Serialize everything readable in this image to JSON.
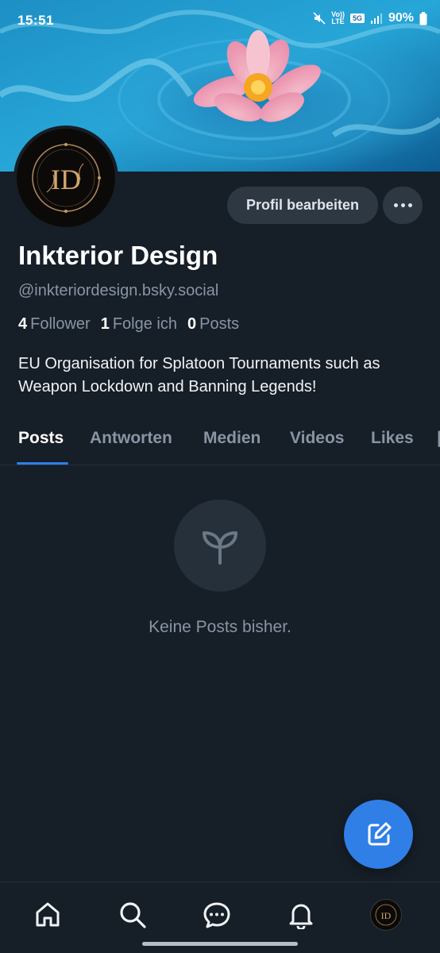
{
  "status_bar": {
    "time": "15:51",
    "volte_top": "Vo))",
    "volte_bottom": "LTE",
    "network": "5G",
    "battery": "90%"
  },
  "profile": {
    "display_name": "Inkterior Design",
    "handle": "@inkteriordesign.bsky.social",
    "avatar_monogram": "ID",
    "stats": {
      "followers_count": "4",
      "followers_label": "Follower",
      "following_count": "1",
      "following_label": "Folge ich",
      "posts_count": "0",
      "posts_label": "Posts"
    },
    "bio": "EU Organisation for Splatoon Tournaments such as Weapon Lockdown and Banning Legends!"
  },
  "actions": {
    "edit_label": "Profil bearbeiten"
  },
  "tabs": [
    {
      "label": "Posts",
      "active": true
    },
    {
      "label": "Antworten",
      "active": false
    },
    {
      "label": "Medien",
      "active": false
    },
    {
      "label": "Videos",
      "active": false
    },
    {
      "label": "Likes",
      "active": false
    }
  ],
  "empty_state": {
    "icon": "sprout-icon",
    "message": "Keine Posts bisher."
  },
  "colors": {
    "background": "#161e27",
    "accent": "#2f7fe6",
    "muted_text": "#8895a4",
    "button_bg": "#2e3843"
  },
  "bottom_nav": [
    "home-icon",
    "search-icon",
    "chat-icon",
    "bell-icon",
    "profile-avatar"
  ]
}
